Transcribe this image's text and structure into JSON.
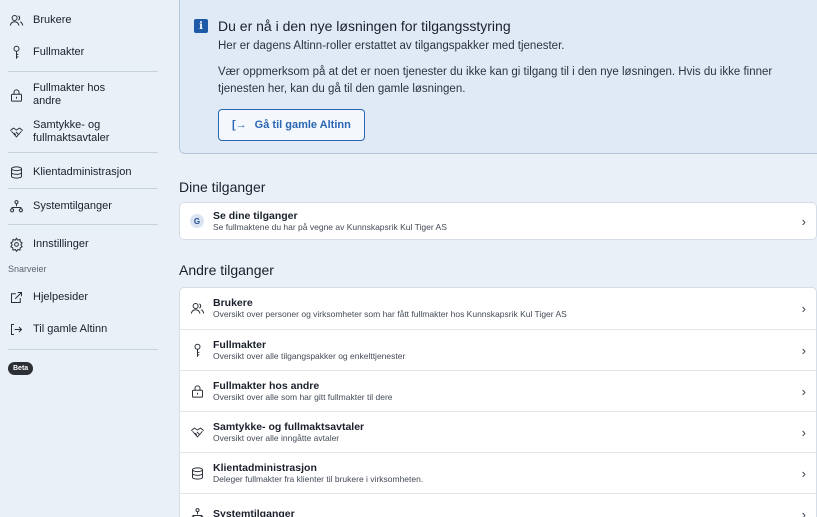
{
  "sidebar": {
    "items": [
      {
        "label": "Brukere",
        "icon": "users-icon"
      },
      {
        "label": "Fullmakter",
        "icon": "key-icon"
      },
      {
        "label": "Fullmakter hos andre",
        "icon": "handbag-icon"
      },
      {
        "label": "Samtykke- og fullmaktsavtaler",
        "icon": "handshake-icon"
      },
      {
        "label": "Klientadministrasjon",
        "icon": "database-icon"
      },
      {
        "label": "Systemtilganger",
        "icon": "hierarchy-icon"
      },
      {
        "label": "Innstillinger",
        "icon": "gear-icon"
      }
    ],
    "shortcuts_label": "Snarveier",
    "shortcuts": [
      {
        "label": "Hjelpesider",
        "icon": "external-link-icon"
      },
      {
        "label": "Til gamle Altinn",
        "icon": "enter-icon"
      }
    ],
    "beta_label": "Beta"
  },
  "banner": {
    "title": "Du er nå i den nye løsningen for tilgangsstyring",
    "line1": "Her er dagens Altinn-roller erstattet av tilgangspakker med tjenester.",
    "line2": "Vær oppmerksom på at det er noen tjenester du ikke kan gi tilgang til i den nye løsningen. Hvis du ikke finner tjenesten her, kan du gå til den gamle løsningen.",
    "button_label": "Gå til gamle Altinn",
    "button_icon": "[→"
  },
  "your_access": {
    "title": "Dine tilganger",
    "row": {
      "badge": "G",
      "title": "Se dine tilganger",
      "desc": "Se fullmaktene du har på vegne av Kunnskapsrik Kul Tiger AS"
    }
  },
  "other_access": {
    "title": "Andre tilganger",
    "rows": [
      {
        "title": "Brukere",
        "desc": "Oversikt over personer og virksomheter som har fått fullmakter hos Kunnskapsrik Kul Tiger AS",
        "icon": "users-icon"
      },
      {
        "title": "Fullmakter",
        "desc": "Oversikt over alle tilgangspakker og enkelttjenester",
        "icon": "key-icon"
      },
      {
        "title": "Fullmakter hos andre",
        "desc": "Oversikt over alle som har gitt fullmakter til dere",
        "icon": "handbag-icon"
      },
      {
        "title": "Samtykke- og fullmaktsavtaler",
        "desc": "Oversikt over alle inngåtte avtaler",
        "icon": "handshake-icon"
      },
      {
        "title": "Klientadministrasjon",
        "desc": "Deleger fullmakter fra klienter til brukere i virksomheten.",
        "icon": "database-icon"
      },
      {
        "title": "Systemtilganger",
        "desc": "",
        "icon": "hierarchy-icon"
      }
    ]
  },
  "chevron": "›"
}
